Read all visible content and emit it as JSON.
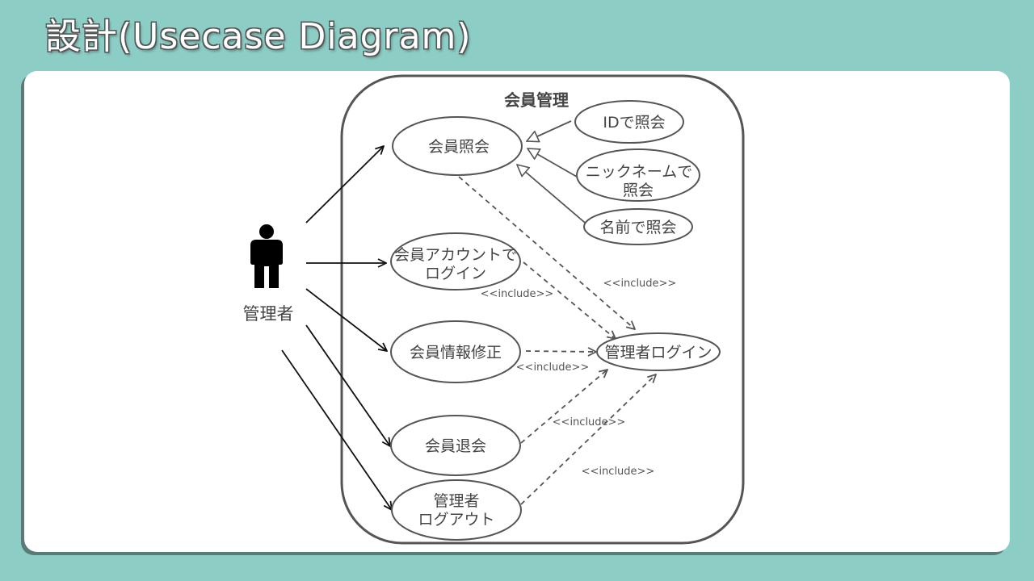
{
  "slide": {
    "title": "設計(Usecase Diagram)"
  },
  "diagram": {
    "system_boundary": "会員管理",
    "actor": "管理者",
    "use_cases": {
      "member_lookup": "会員照会",
      "lookup_by_id": "IDで照会",
      "lookup_by_nickname_1": "ニックネームで",
      "lookup_by_nickname_2": "照会",
      "lookup_by_name": "名前で照会",
      "member_account_login_1": "会員アカウントで",
      "member_account_login_2": "ログイン",
      "member_info_edit": "会員情報修正",
      "member_withdraw": "会員退会",
      "admin_logout_1": "管理者",
      "admin_logout_2": "ログアウト",
      "admin_login": "管理者ログイン"
    },
    "include_labels": [
      "<<include>>",
      "<<include>>",
      "<<include>>",
      "<<include>>",
      "<<include>>"
    ],
    "colors": {
      "background": "#8ccdc5",
      "panel": "#ffffff",
      "stroke": "#555555"
    }
  }
}
